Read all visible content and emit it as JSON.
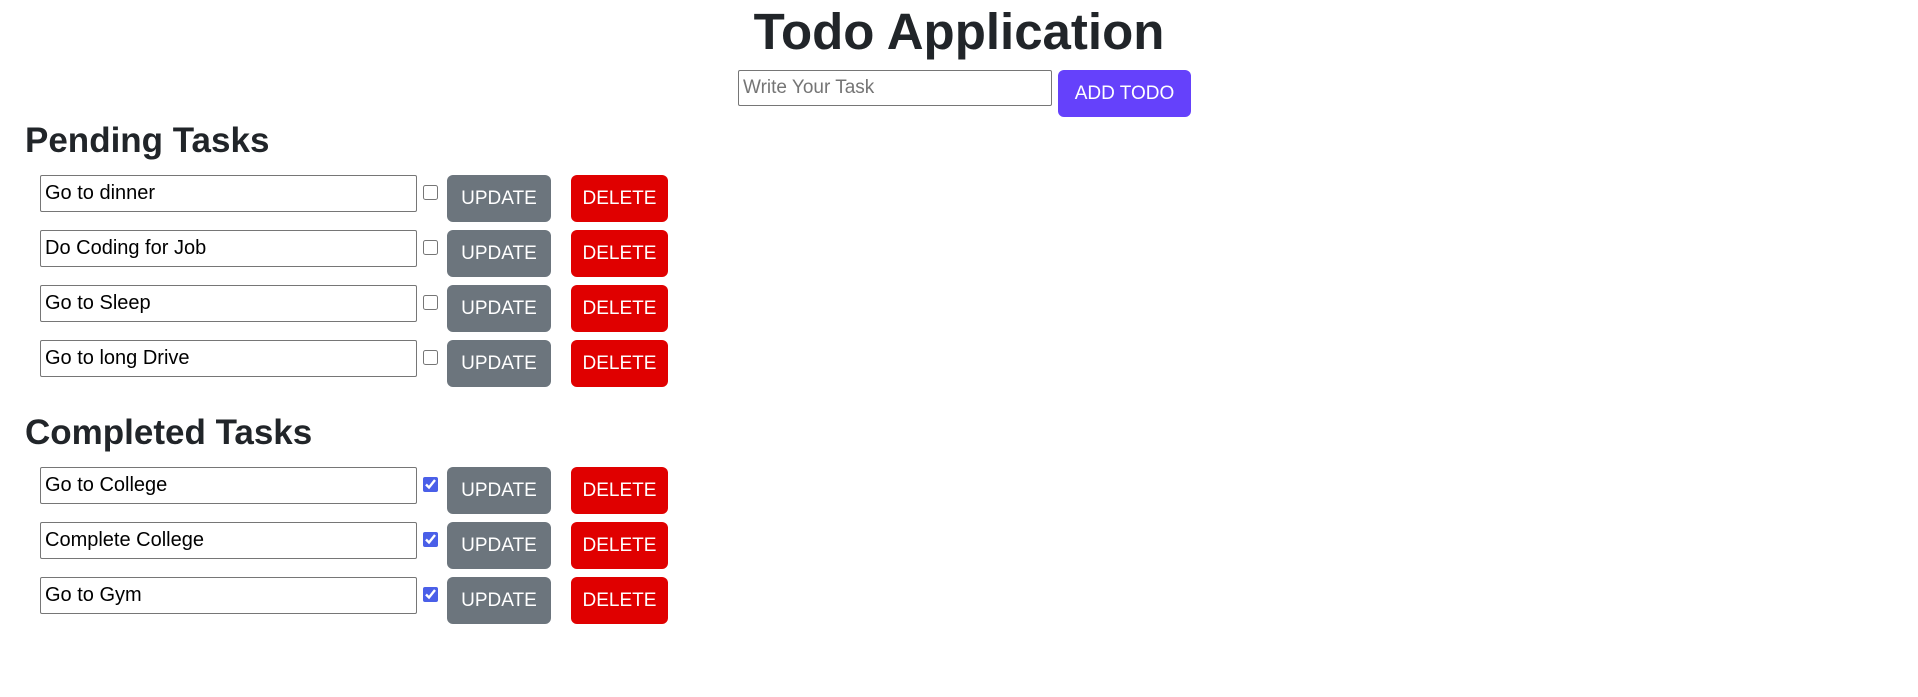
{
  "app": {
    "title": "Todo Application"
  },
  "add_form": {
    "input_value": "",
    "placeholder": "Write Your Task",
    "add_label": "ADD TODO"
  },
  "pending": {
    "heading": "Pending Tasks",
    "items": [
      {
        "text": "Go to dinner",
        "checked": false
      },
      {
        "text": "Do Coding for Job",
        "checked": false
      },
      {
        "text": "Go to Sleep",
        "checked": false
      },
      {
        "text": "Go to long Drive",
        "checked": false
      }
    ]
  },
  "completed": {
    "heading": "Completed Tasks",
    "items": [
      {
        "text": "Go to College",
        "checked": true
      },
      {
        "text": "Complete College",
        "checked": true
      },
      {
        "text": "Go to Gym",
        "checked": true
      }
    ]
  },
  "buttons": {
    "update_label": "UPDATE",
    "delete_label": "DELETE"
  },
  "colors": {
    "add_button": "#6541fb",
    "update_button": "#6c757d",
    "delete_button": "#e00000",
    "checkbox_accent": "#4a5fe8"
  }
}
